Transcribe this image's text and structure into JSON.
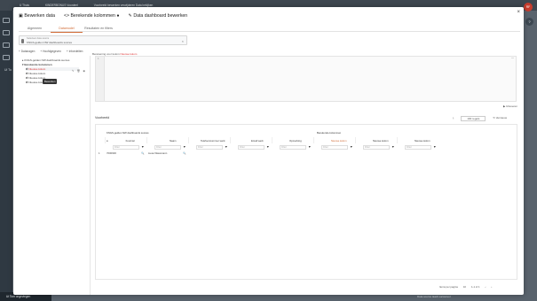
{
  "app": {
    "topbar_items": [
      "U Thuis",
      "KINDERBONUS Voordeel",
      "Voorbeeld bewerken verwijderen Data bekijken"
    ],
    "avatar_initials": "RF",
    "left_rail_label": "Ui Tu",
    "dark_tab": "Ui Tom ongeviegen",
    "bottom_status": "Data source laadt succesvol"
  },
  "modal": {
    "title_edit": "Bewerken data",
    "title_calc": "Berekende kolommen",
    "title_dashboard": "Data dashboard bewerken",
    "tabs": [
      "Algemeen",
      "Datamodel",
      "Resultaten en filters"
    ],
    "active_tab": 1,
    "source_field_label": "Selecteer data source",
    "source_field_value": "KNGS-gelden NW dashboards succes",
    "toolbar": [
      "Datanagen",
      "Hoofdgegeven",
      "Infoedeiten"
    ],
    "tree": {
      "nodes": [
        "KNGS-gelden NW dashboards succes",
        "Berekende kolommen",
        "Nieuwe kolom",
        "Nieuwe kolom",
        "Nieuwe kolom",
        "Nieuwe kolom"
      ],
      "tooltip": "Bewerken"
    },
    "editor_label": "Berekening voor kolom",
    "editor_label_highlight": "Nieuwe kolom",
    "editor_gutter": "1",
    "run_button": "Uitvoeren",
    "preview_title": "Voorbeeld",
    "preview_rows_label": "100 regels",
    "preview_refresh": "Vernieuw",
    "group_source": "KNGS-gelden NW dashboards succes",
    "group_calc": "Berekende kolommen",
    "columns": [
      "Fournier",
      "Naam",
      "Telefoonnummer werk",
      "Email werk",
      "Opmerking",
      "Nieuwe kolom",
      "Nieuwe kolom",
      "Nieuwe kolom"
    ],
    "filter_placeholder": "Filter",
    "row_values": [
      "7000900",
      "Liesa Wassmann"
    ],
    "pagination": [
      "Items per pagina",
      "10",
      "1-1 of 1"
    ],
    "colors": {
      "accent": "#d16a34",
      "highlight_text": "#dd3333",
      "overlay": "#59636d"
    }
  }
}
